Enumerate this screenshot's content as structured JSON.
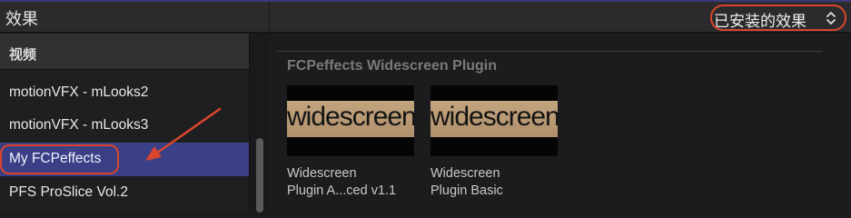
{
  "header": {
    "title": "效果",
    "filter_label": "已安装的效果"
  },
  "sidebar": {
    "section_label": "视频",
    "items": [
      {
        "label": "motionVFX - mLooks2"
      },
      {
        "label": "motionVFX - mLooks3"
      },
      {
        "label": "My FCPeffects",
        "selected": true
      },
      {
        "label": "PFS ProSlice Vol.2"
      }
    ]
  },
  "main": {
    "group_title": "FCPeffects Widescreen Plugin",
    "tiles": [
      {
        "thumb_text": "widescreen",
        "line1": "Widescreen",
        "line2": "Plugin A...ced v1.1"
      },
      {
        "thumb_text": "widescreen",
        "line1": "Widescreen",
        "line2": "Plugin Basic"
      }
    ]
  },
  "colors": {
    "annotation": "#d9462c",
    "selection": "#3a3f86",
    "header_accent": "#3a3a7a"
  },
  "icons": {
    "filter_chevron": "chevron-up-down-icon",
    "annotation_arrow": "arrow-icon"
  }
}
